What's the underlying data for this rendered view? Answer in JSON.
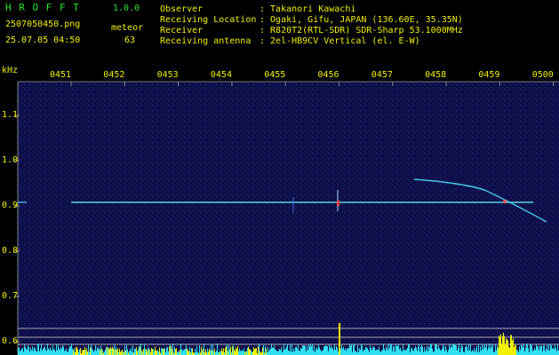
{
  "header": {
    "app_title": "H R O F F T",
    "version": "1.0.0",
    "filename": "2507050450.png",
    "event_label": "meteor",
    "datetime": "25.07.05 04:50",
    "event_count": "63",
    "info_labels": [
      "Observer",
      "Receiving Location",
      "Receiver",
      "Receiving antenna"
    ],
    "info_values": [
      ": Takanori Kawachi",
      ": Ogaki, Gifu, JAPAN (136.60E, 35.35N)",
      ": R820T2(RTL-SDR) SDR-Sharp 53.1000MHz",
      ": 2el-HB9CV Vertical (el. E-W)"
    ]
  },
  "axis": {
    "y_unit": "kHz",
    "time_ticks": [
      "0451",
      "0452",
      "0453",
      "0454",
      "0455",
      "0456",
      "0457",
      "0458",
      "0459",
      "0500"
    ],
    "freq_ticks": [
      "1.1",
      "1.0",
      "0.9",
      "0.8",
      "0.7",
      "0.6"
    ]
  },
  "colors": {
    "background": "#10104a",
    "carrier": "#4fd8e0",
    "text_green": "#22e622",
    "text_yellow": "#f0f000",
    "bars_cyan": "#30e0f0"
  }
}
